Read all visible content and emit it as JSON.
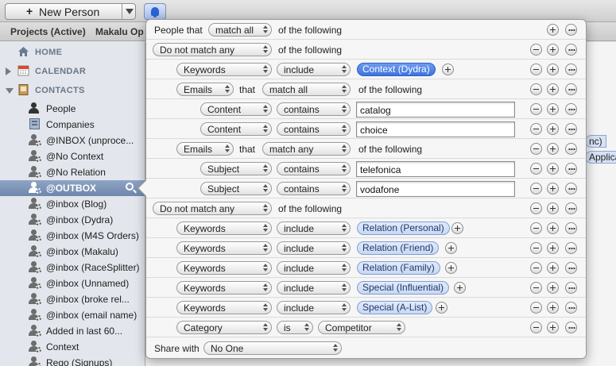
{
  "toolbar": {
    "new_person_label": "New Person",
    "tabs": [
      "Projects (Active)",
      "Makalu Op"
    ]
  },
  "sidebar": {
    "sections": [
      {
        "label": "HOME",
        "icon": "house-icon"
      },
      {
        "label": "CALENDAR",
        "icon": "calendar-icon"
      },
      {
        "label": "CONTACTS",
        "icon": "address-book-icon"
      }
    ],
    "items": [
      {
        "label": "People",
        "icon": "person-icon"
      },
      {
        "label": "Companies",
        "icon": "building-icon"
      },
      {
        "label": "@INBOX (unproce...",
        "icon": "smart-group-icon"
      },
      {
        "label": "@No Context",
        "icon": "smart-group-icon"
      },
      {
        "label": "@No Relation",
        "icon": "smart-group-icon"
      },
      {
        "label": "@OUTBOX",
        "icon": "smart-group-icon",
        "selected": true
      },
      {
        "label": "@inbox (Blog)",
        "icon": "smart-group-icon"
      },
      {
        "label": "@inbox (Dydra)",
        "icon": "smart-group-icon"
      },
      {
        "label": "@inbox (M4S Orders)",
        "icon": "smart-group-icon"
      },
      {
        "label": "@inbox (Makalu)",
        "icon": "smart-group-icon"
      },
      {
        "label": "@inbox (RaceSplitter)",
        "icon": "smart-group-icon"
      },
      {
        "label": "@inbox (Unnamed)",
        "icon": "smart-group-icon"
      },
      {
        "label": "@inbox (broke rel...",
        "icon": "smart-group-icon"
      },
      {
        "label": "@inbox (email name)",
        "icon": "smart-group-icon"
      },
      {
        "label": "Added in last 60...",
        "icon": "smart-group-icon"
      },
      {
        "label": "Context",
        "icon": "smart-group-icon"
      },
      {
        "label": "Rego (Signups)",
        "icon": "smart-group-icon"
      }
    ]
  },
  "background": {
    "chip1": "nc)",
    "chip2": "Applica"
  },
  "rules": {
    "r0": {
      "prefix": "People that",
      "match": "match all",
      "suffix": "of the following"
    },
    "r1": {
      "match": "Do not match any",
      "suffix": "of the following"
    },
    "r2": {
      "field": "Keywords",
      "op": "include",
      "tag": "Context (Dydra)"
    },
    "r3": {
      "field": "Emails",
      "that": "that",
      "match": "match all",
      "suffix": "of the following"
    },
    "r4": {
      "field": "Content",
      "op": "contains",
      "value": "catalog"
    },
    "r5": {
      "field": "Content",
      "op": "contains",
      "value": "choice"
    },
    "r6": {
      "field": "Emails",
      "that": "that",
      "match": "match any",
      "suffix": "of the following"
    },
    "r7": {
      "field": "Subject",
      "op": "contains",
      "value": "telefonica"
    },
    "r8": {
      "field": "Subject",
      "op": "contains",
      "value": "vodafone"
    },
    "r9": {
      "match": "Do not match any",
      "suffix": "of the following"
    },
    "r10": {
      "field": "Keywords",
      "op": "include",
      "tag": "Relation (Personal)"
    },
    "r11": {
      "field": "Keywords",
      "op": "include",
      "tag": "Relation (Friend)"
    },
    "r12": {
      "field": "Keywords",
      "op": "include",
      "tag": "Relation (Family)"
    },
    "r13": {
      "field": "Keywords",
      "op": "include",
      "tag": "Special (Influential)"
    },
    "r14": {
      "field": "Keywords",
      "op": "include",
      "tag": "Special (A-List)"
    },
    "r15": {
      "field": "Category",
      "op": "is",
      "value": "Competitor"
    },
    "share": {
      "label": "Share with",
      "value": "No One"
    }
  }
}
